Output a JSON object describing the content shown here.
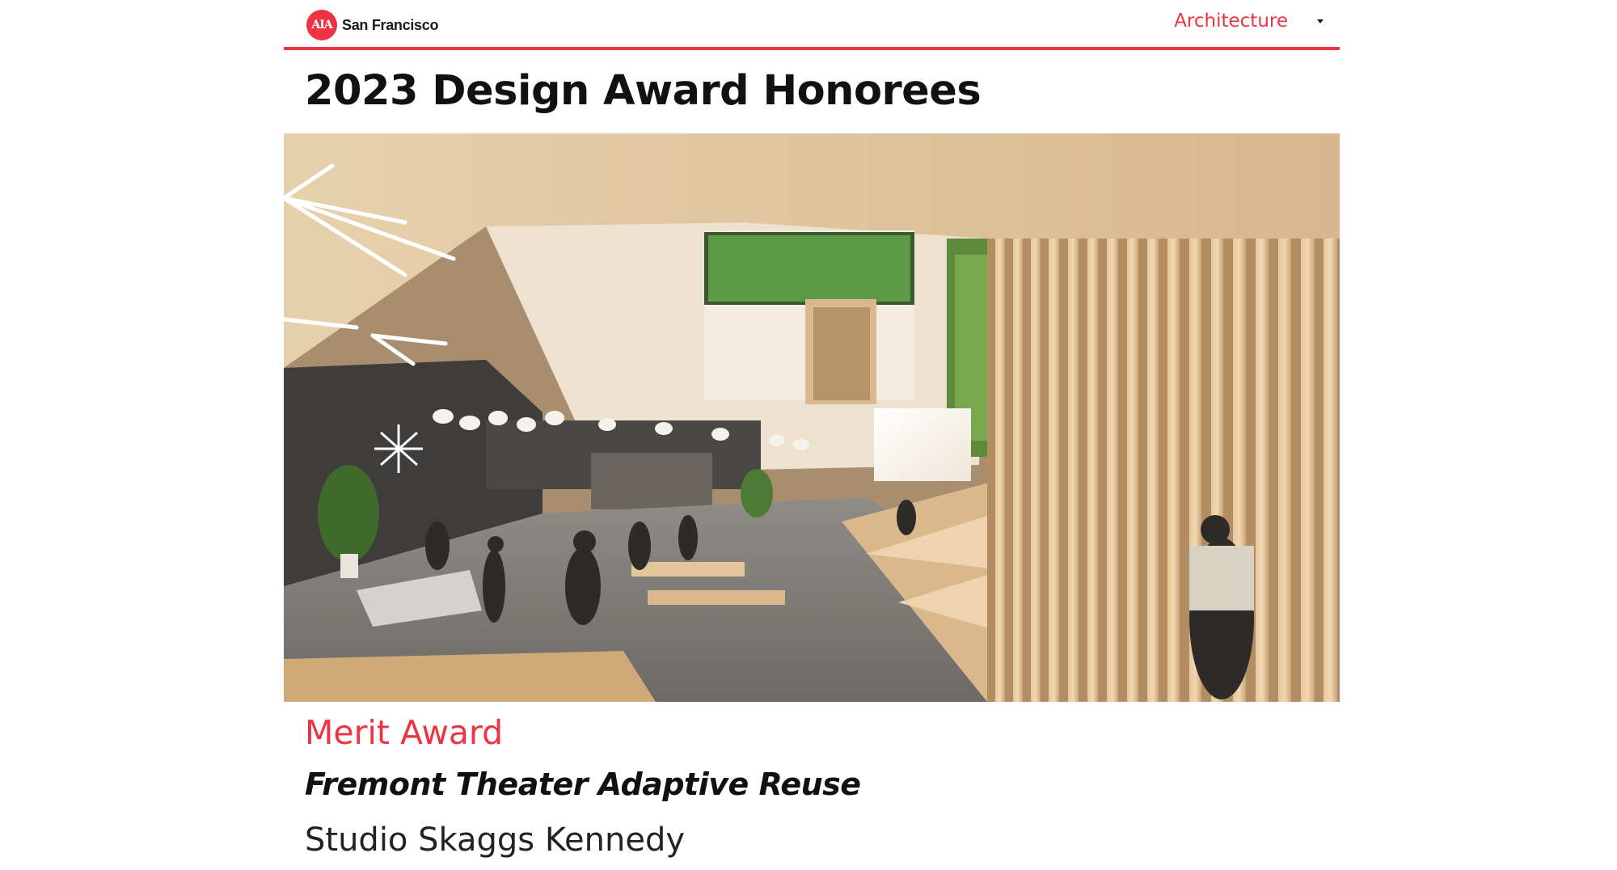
{
  "header": {
    "logo_badge": "AIA",
    "logo_text": "San Francisco",
    "nav_label": "Architecture",
    "nav_caret_icon": "caret-down-icon",
    "accent_color": "#ef3340"
  },
  "main": {
    "title": "2023 Design Award Honorees",
    "hero_image": "interior-rendering-photo",
    "award": "Merit Award",
    "project": "Fremont Theater Adaptive Reuse",
    "firm": "Studio Skaggs Kennedy"
  }
}
